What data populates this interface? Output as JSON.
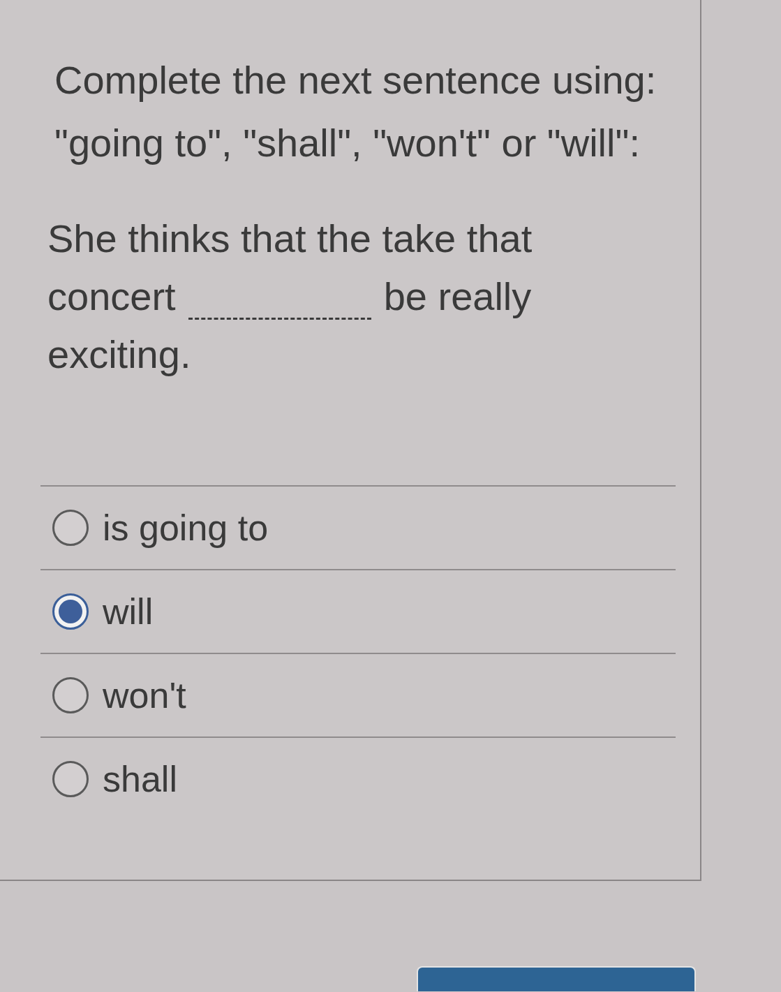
{
  "instruction_lines": [
    "Complete the next sentence using:",
    "\"going to\", \"shall\", \"won't\" or \"will\":"
  ],
  "question": {
    "before_blank": [
      "She thinks that the take that",
      "concert"
    ],
    "after_blank": [
      "be really",
      "exciting."
    ]
  },
  "options": [
    {
      "label": "is going to",
      "selected": false
    },
    {
      "label": "will",
      "selected": true
    },
    {
      "label": "won't",
      "selected": false
    },
    {
      "label": "shall",
      "selected": false
    }
  ],
  "action_button": {
    "kind": "primary"
  }
}
